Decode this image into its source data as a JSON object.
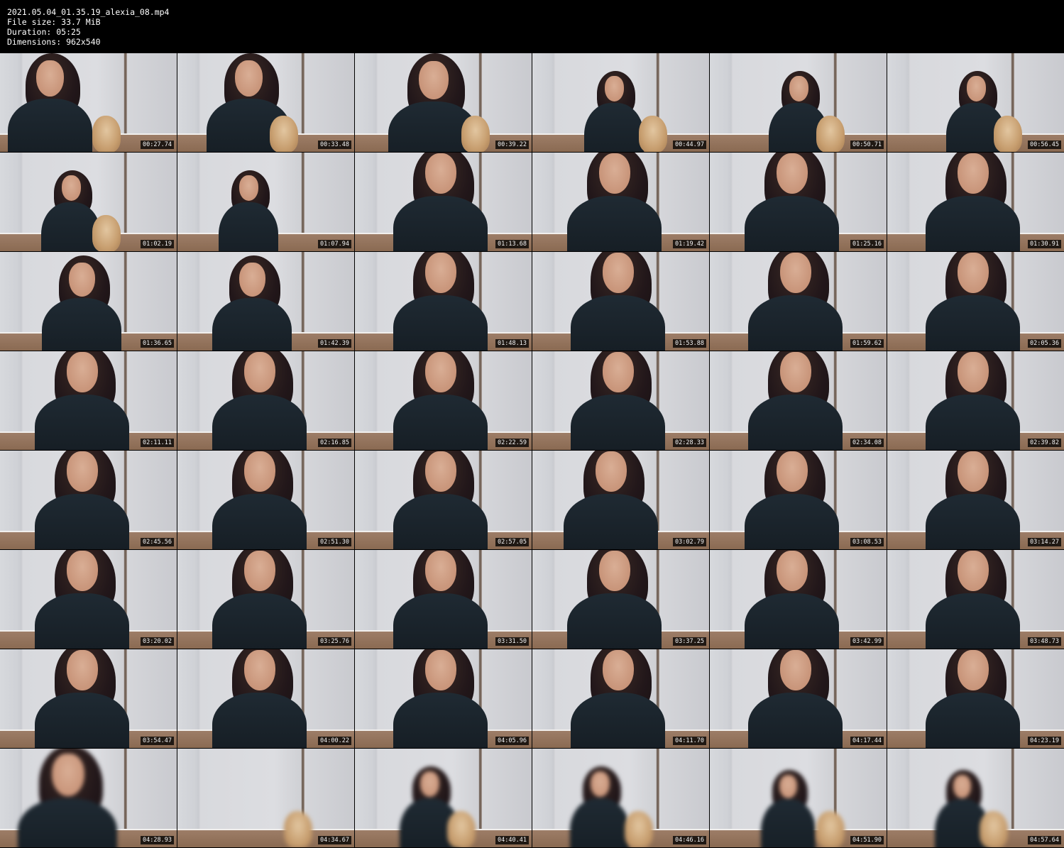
{
  "header": {
    "filename": "2021.05.04_01.35.19_alexia_08.mp4",
    "file_size": "File size: 33.7 MiB",
    "duration": "Duration: 05:25",
    "dimensions": "Dimensions: 962x540"
  },
  "thumbnails": [
    {
      "timestamp": "00:27.74"
    },
    {
      "timestamp": "00:33.48"
    },
    {
      "timestamp": "00:39.22"
    },
    {
      "timestamp": "00:44.97"
    },
    {
      "timestamp": "00:50.71"
    },
    {
      "timestamp": "00:56.45"
    },
    {
      "timestamp": "01:02.19"
    },
    {
      "timestamp": "01:07.94"
    },
    {
      "timestamp": "01:13.68"
    },
    {
      "timestamp": "01:19.42"
    },
    {
      "timestamp": "01:25.16"
    },
    {
      "timestamp": "01:30.91"
    },
    {
      "timestamp": "01:36.65"
    },
    {
      "timestamp": "01:42.39"
    },
    {
      "timestamp": "01:48.13"
    },
    {
      "timestamp": "01:53.88"
    },
    {
      "timestamp": "01:59.62"
    },
    {
      "timestamp": "02:05.36"
    },
    {
      "timestamp": "02:11.11"
    },
    {
      "timestamp": "02:16.85"
    },
    {
      "timestamp": "02:22.59"
    },
    {
      "timestamp": "02:28.33"
    },
    {
      "timestamp": "02:34.08"
    },
    {
      "timestamp": "02:39.82"
    },
    {
      "timestamp": "02:45.56"
    },
    {
      "timestamp": "02:51.30"
    },
    {
      "timestamp": "02:57.05"
    },
    {
      "timestamp": "03:02.79"
    },
    {
      "timestamp": "03:08.53"
    },
    {
      "timestamp": "03:14.27"
    },
    {
      "timestamp": "03:20.02"
    },
    {
      "timestamp": "03:25.76"
    },
    {
      "timestamp": "03:31.50"
    },
    {
      "timestamp": "03:37.25"
    },
    {
      "timestamp": "03:42.99"
    },
    {
      "timestamp": "03:48.73"
    },
    {
      "timestamp": "03:54.47"
    },
    {
      "timestamp": "04:00.22"
    },
    {
      "timestamp": "04:05.96"
    },
    {
      "timestamp": "04:11.70"
    },
    {
      "timestamp": "04:17.44"
    },
    {
      "timestamp": "04:23.19"
    },
    {
      "timestamp": "04:28.93"
    },
    {
      "timestamp": "04:34.67"
    },
    {
      "timestamp": "04:40.41"
    },
    {
      "timestamp": "04:46.16"
    },
    {
      "timestamp": "04:51.90"
    },
    {
      "timestamp": "04:57.64"
    }
  ]
}
